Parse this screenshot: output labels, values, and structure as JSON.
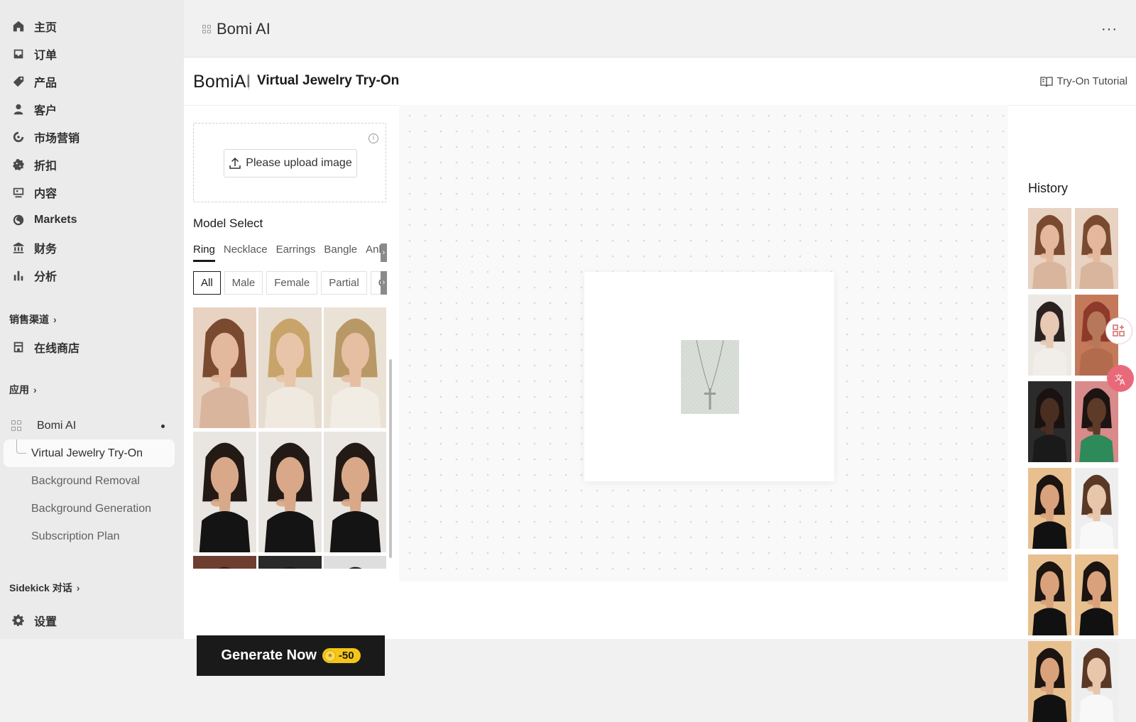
{
  "sidebar": {
    "nav": [
      {
        "label": "主页",
        "icon": "home-icon"
      },
      {
        "label": "订单",
        "icon": "inbox-icon"
      },
      {
        "label": "产品",
        "icon": "tag-icon"
      },
      {
        "label": "客户",
        "icon": "person-icon"
      },
      {
        "label": "市场营销",
        "icon": "target-icon"
      },
      {
        "label": "折扣",
        "icon": "discount-icon"
      },
      {
        "label": "内容",
        "icon": "content-icon"
      },
      {
        "label": "Markets",
        "icon": "globe-icon"
      },
      {
        "label": "财务",
        "icon": "bank-icon"
      },
      {
        "label": "分析",
        "icon": "chart-bar-icon"
      }
    ],
    "sales_channels_label": "销售渠道",
    "online_store_label": "在线商店",
    "apps_label": "应用",
    "app_name": "Bomi AI",
    "app_subitems": {
      "active": "Virtual Jewelry Try-On",
      "items": [
        "Background Removal",
        "Background Generation",
        "Subscription Plan"
      ]
    },
    "sidekick_label": "Sidekick 对话",
    "settings_label": "设置"
  },
  "topbar": {
    "title": "Bomi AI",
    "more": "···"
  },
  "app": {
    "brand": "BomiAI",
    "title": "Virtual Jewelry Try-On",
    "tutorial_label": "Try-On Tutorial",
    "upload_label": "Please upload image",
    "model_select_label": "Model Select",
    "category_tabs": [
      "Ring",
      "Necklace",
      "Earrings",
      "Bangle",
      "Ankle"
    ],
    "active_category": "Ring",
    "filters": [
      "All",
      "Male",
      "Female",
      "Partial",
      "C"
    ],
    "active_filter": "All",
    "generate_label": "Generate Now",
    "credit_cost": "-50",
    "history_title": "History"
  },
  "colors": {
    "sidebar_bg": "#ebebeb",
    "accent_dark": "#1a1a1a",
    "credit_yellow": "#f5c518",
    "canvas_bg": "#f9f9f9"
  }
}
